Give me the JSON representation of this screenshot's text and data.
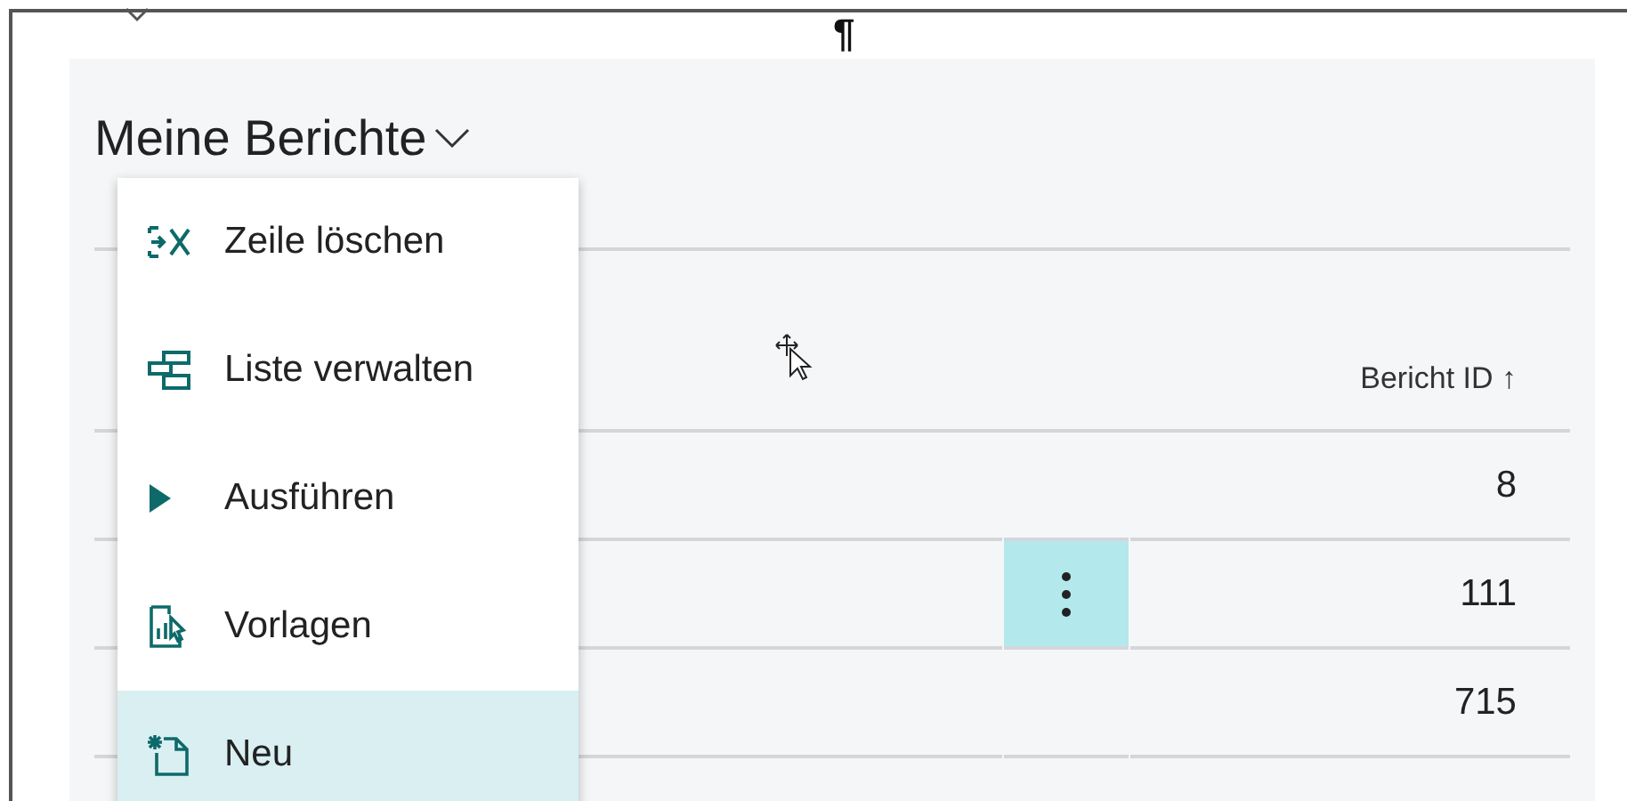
{
  "document": {
    "paragraph_mark": "¶"
  },
  "page": {
    "title": "Meine Berichte"
  },
  "table": {
    "columns": [
      "Bericht ID ↑"
    ],
    "rows": [
      {
        "bericht_id": "8",
        "selected": false
      },
      {
        "bericht_id": "111",
        "selected": true
      },
      {
        "bericht_id": "715",
        "selected": false
      }
    ]
  },
  "menu": {
    "items": [
      {
        "kind": "delete-row",
        "label": "Zeile löschen",
        "selected": false
      },
      {
        "kind": "manage-list",
        "label": "Liste verwalten",
        "selected": false
      },
      {
        "kind": "run",
        "label": "Ausführen",
        "selected": false
      },
      {
        "kind": "templates",
        "label": "Vorlagen",
        "selected": false
      },
      {
        "kind": "new",
        "label": "Neu",
        "selected": true
      }
    ]
  }
}
